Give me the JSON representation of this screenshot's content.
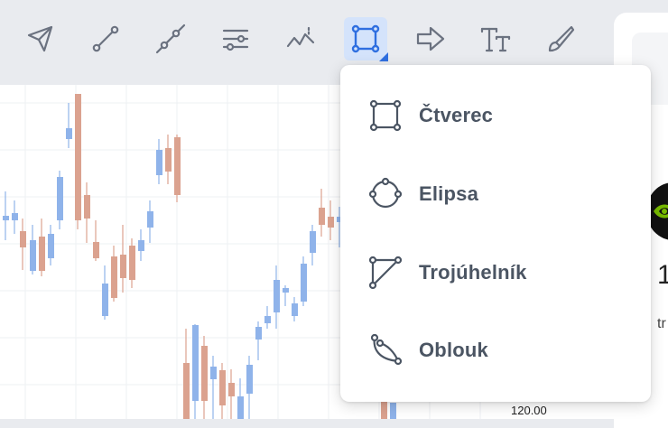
{
  "toolbar": {
    "tools": [
      {
        "name": "cursor-arrow-icon"
      },
      {
        "name": "line-tool-icon"
      },
      {
        "name": "ray-tool-icon"
      },
      {
        "name": "parallel-channel-icon"
      },
      {
        "name": "pattern-tool-icon"
      },
      {
        "name": "shapes-tool-icon",
        "active": true
      },
      {
        "name": "arrow-tool-icon"
      },
      {
        "name": "text-tool-icon"
      },
      {
        "name": "brush-tool-icon"
      }
    ],
    "active_tool": "shapes",
    "accent_color": "#2f6fe0"
  },
  "shape_menu": {
    "items": [
      {
        "label": "Čtverec",
        "icon": "square-shape-icon"
      },
      {
        "label": "Elipsa",
        "icon": "ellipse-shape-icon"
      },
      {
        "label": "Trojúhelník",
        "icon": "triangle-shape-icon"
      },
      {
        "label": "Oblouk",
        "icon": "arc-shape-icon"
      }
    ]
  },
  "chart": {
    "price_label": "120.00",
    "up_color": "#8fb3ea",
    "down_color": "#dba28f"
  },
  "right_panel": {
    "number": "1",
    "sub": "tr"
  }
}
